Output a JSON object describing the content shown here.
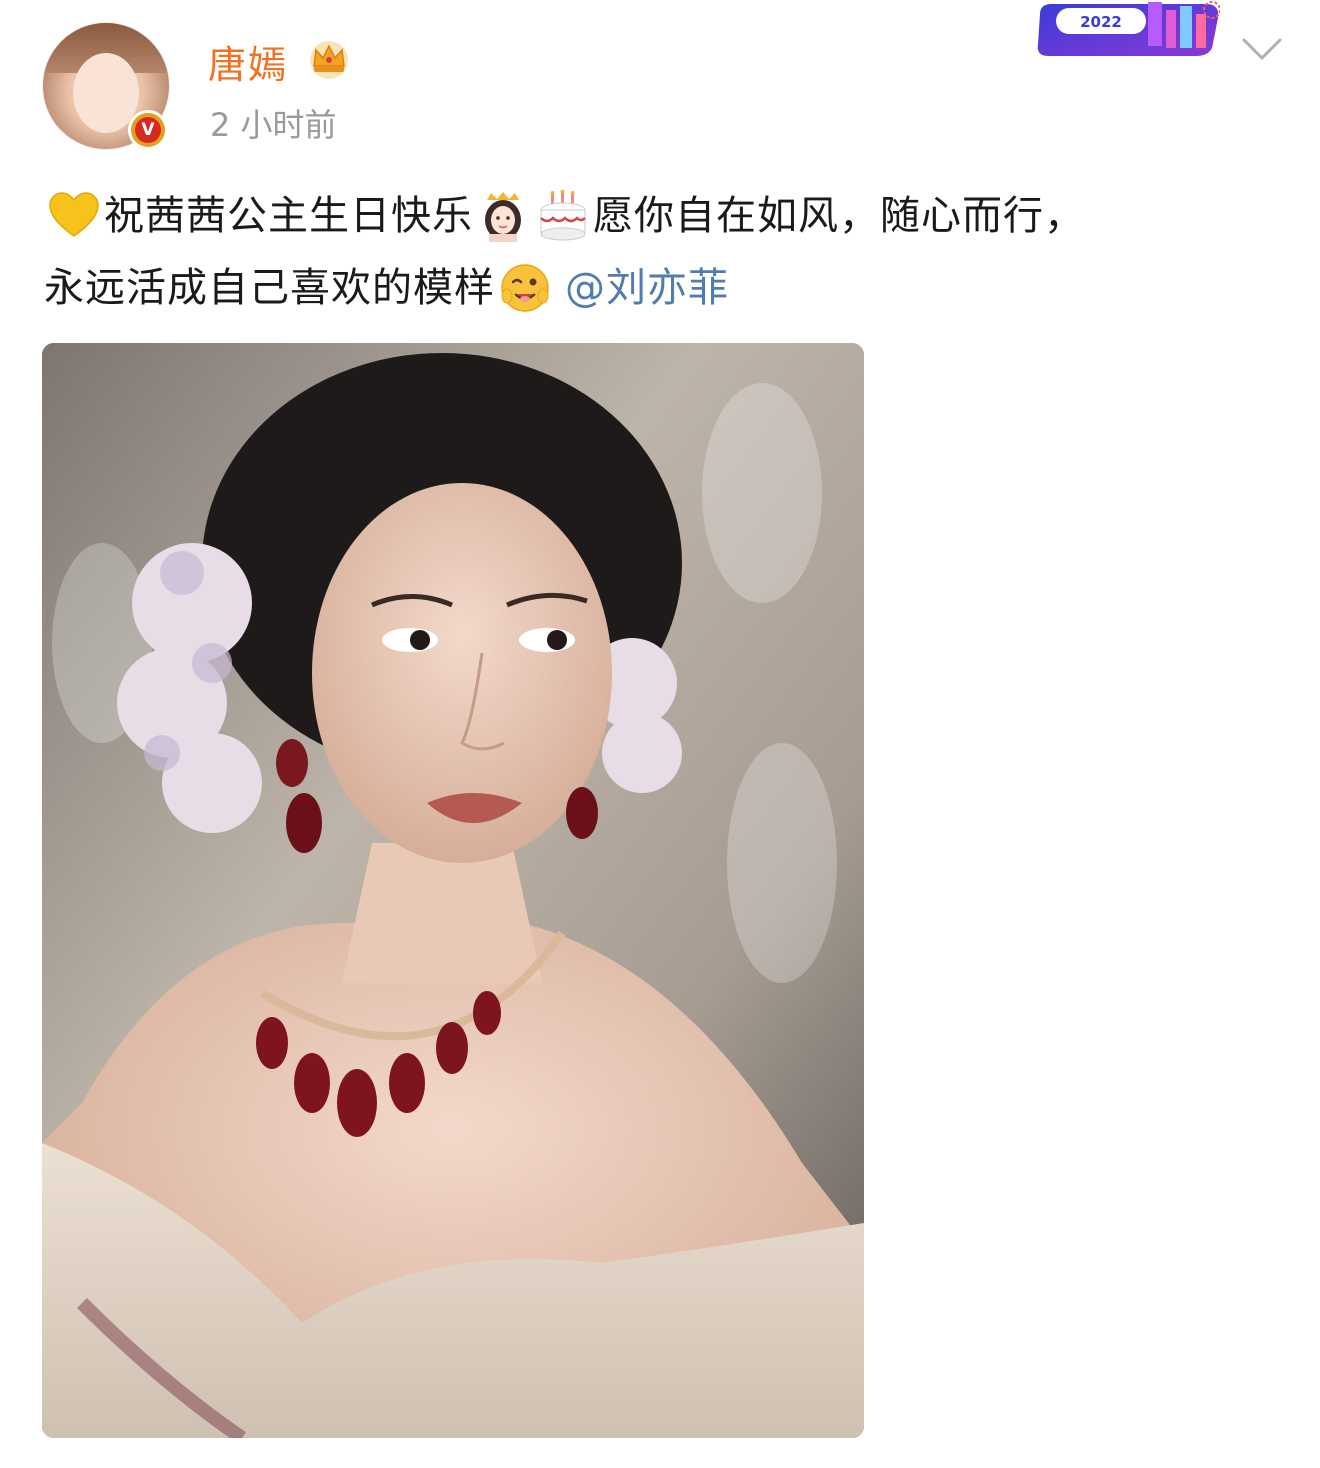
{
  "post": {
    "author": {
      "name": "唐嫣",
      "verified_badge": "V",
      "avatar_icon": "avatar-photo",
      "crown_icon": "crown-badge-icon"
    },
    "timestamp": "2 小时前",
    "text": {
      "line1_part1": "祝茜茜公主生日快乐",
      "line1_part2": "愿你自在如风，随心而行，",
      "line2_part1": "永远活成自己喜欢的模样",
      "mention": "@刘亦菲"
    },
    "emojis": [
      "yellow-heart-icon",
      "princess-icon",
      "birthday-cake-icon",
      "wink-face-icon"
    ],
    "banner": {
      "year": "2022"
    },
    "image": {
      "description_icon": "portrait-photo"
    }
  },
  "colors": {
    "username": "#f2701f",
    "mention": "#507daf",
    "timestamp": "#9a9a9a",
    "text": "#1a1a1a"
  }
}
